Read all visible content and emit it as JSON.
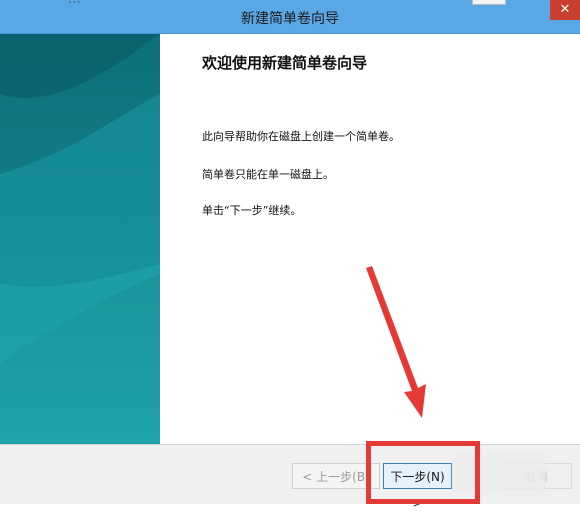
{
  "window": {
    "title": "新建简单卷向导",
    "close_glyph": "✕",
    "background_strip_text": "…"
  },
  "content": {
    "heading": "欢迎使用新建简单卷向导",
    "paragraph1": "此向导帮助你在磁盘上创建一个简单卷。",
    "paragraph2": "简单卷只能在单一磁盘上。",
    "paragraph3": "单击“下一步”继续。"
  },
  "footer": {
    "back_label": "< 上一步(B)",
    "next_label": "下一步(N) >",
    "cancel_label": "取消"
  },
  "annotation": {
    "highlight_color": "#e53935",
    "arrow_color": "#e53935"
  }
}
